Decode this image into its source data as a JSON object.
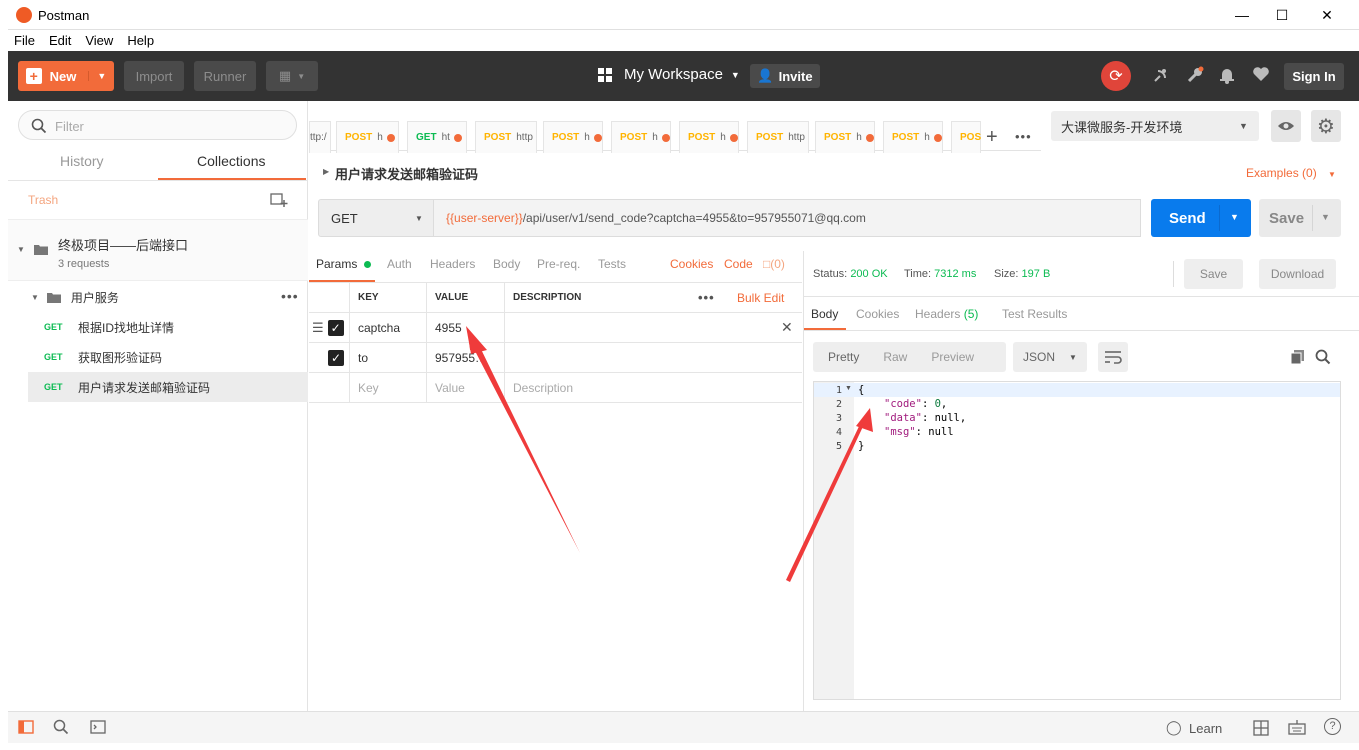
{
  "window": {
    "title": "Postman"
  },
  "menu": [
    "File",
    "Edit",
    "View",
    "Help"
  ],
  "header": {
    "new_label": "New",
    "import_label": "Import",
    "runner_label": "Runner",
    "workspace_label": "My Workspace",
    "invite_label": "Invite",
    "signin_label": "Sign In"
  },
  "sidebar": {
    "filter_placeholder": "Filter",
    "tabs": [
      "History",
      "Collections"
    ],
    "active_tab": "Collections",
    "trash_label": "Trash",
    "collection": {
      "name": "终极项目——后端接口",
      "count": "3 requests"
    },
    "folder": "用户服务",
    "requests": [
      {
        "method": "GET",
        "name": "根据ID找地址详情"
      },
      {
        "method": "GET",
        "name": "获取图形验证码"
      },
      {
        "method": "GET",
        "name": "用户请求发送邮箱验证码"
      }
    ]
  },
  "request_tabs": [
    {
      "method": "",
      "url": "ttp:/"
    },
    {
      "method": "POST",
      "url": "h"
    },
    {
      "method": "GET",
      "url": "ht"
    },
    {
      "method": "POST",
      "url": "http"
    },
    {
      "method": "POST",
      "url": "h"
    },
    {
      "method": "POST",
      "url": "h"
    },
    {
      "method": "POST",
      "url": "h"
    },
    {
      "method": "POST",
      "url": "http"
    },
    {
      "method": "POST",
      "url": "h"
    },
    {
      "method": "POST",
      "url": "h"
    },
    {
      "method": "POS",
      "url": ""
    }
  ],
  "environment": "大课微服务-开发环境",
  "request": {
    "name": "用户请求发送邮箱验证码",
    "examples_label": "Examples (0)",
    "method": "GET",
    "url_var": "{{user-server}}",
    "url_rest": "/api/user/v1/send_code?captcha=4955&to=957955071@qq.com",
    "send_label": "Send",
    "save_label": "Save"
  },
  "request_tabs_sub": {
    "params": "Params",
    "auth": "Auth",
    "headers": "Headers",
    "body": "Body",
    "prereq": "Pre-req.",
    "tests": "Tests",
    "cookies": "Cookies",
    "code": "Code",
    "comments": "(0)"
  },
  "params": {
    "headers": [
      "KEY",
      "VALUE",
      "DESCRIPTION"
    ],
    "bulk_edit": "Bulk Edit",
    "rows": [
      {
        "key": "captcha",
        "value": "4955",
        "description": ""
      },
      {
        "key": "to",
        "value": "957955…",
        "description": ""
      }
    ],
    "placeholder_key": "Key",
    "placeholder_value": "Value",
    "placeholder_description": "Description"
  },
  "response": {
    "status_label": "Status:",
    "status_value": "200 OK",
    "time_label": "Time:",
    "time_value": "7312 ms",
    "size_label": "Size:",
    "size_value": "197 B",
    "save_label": "Save",
    "download_label": "Download",
    "tabs": {
      "body": "Body",
      "cookies": "Cookies",
      "headers": "Headers",
      "headers_count": "(5)",
      "tests": "Test Results"
    },
    "views": [
      "Pretty",
      "Raw",
      "Preview"
    ],
    "format": "JSON",
    "lines": [
      "1",
      "2",
      "3",
      "4",
      "5"
    ],
    "code": {
      "open": "{",
      "l2_key": "\"code\"",
      "l2_val": "0",
      "l3_key": "\"data\"",
      "l3_val": "null",
      "l4_key": "\"msg\"",
      "l4_val": "null",
      "close": "}"
    }
  },
  "footer": {
    "learn_label": "Learn"
  },
  "colors": {
    "accent": "#f26b3a",
    "send": "#097bed",
    "header_bg": "#333333",
    "get": "#0cbb52",
    "post": "#ffb400"
  }
}
